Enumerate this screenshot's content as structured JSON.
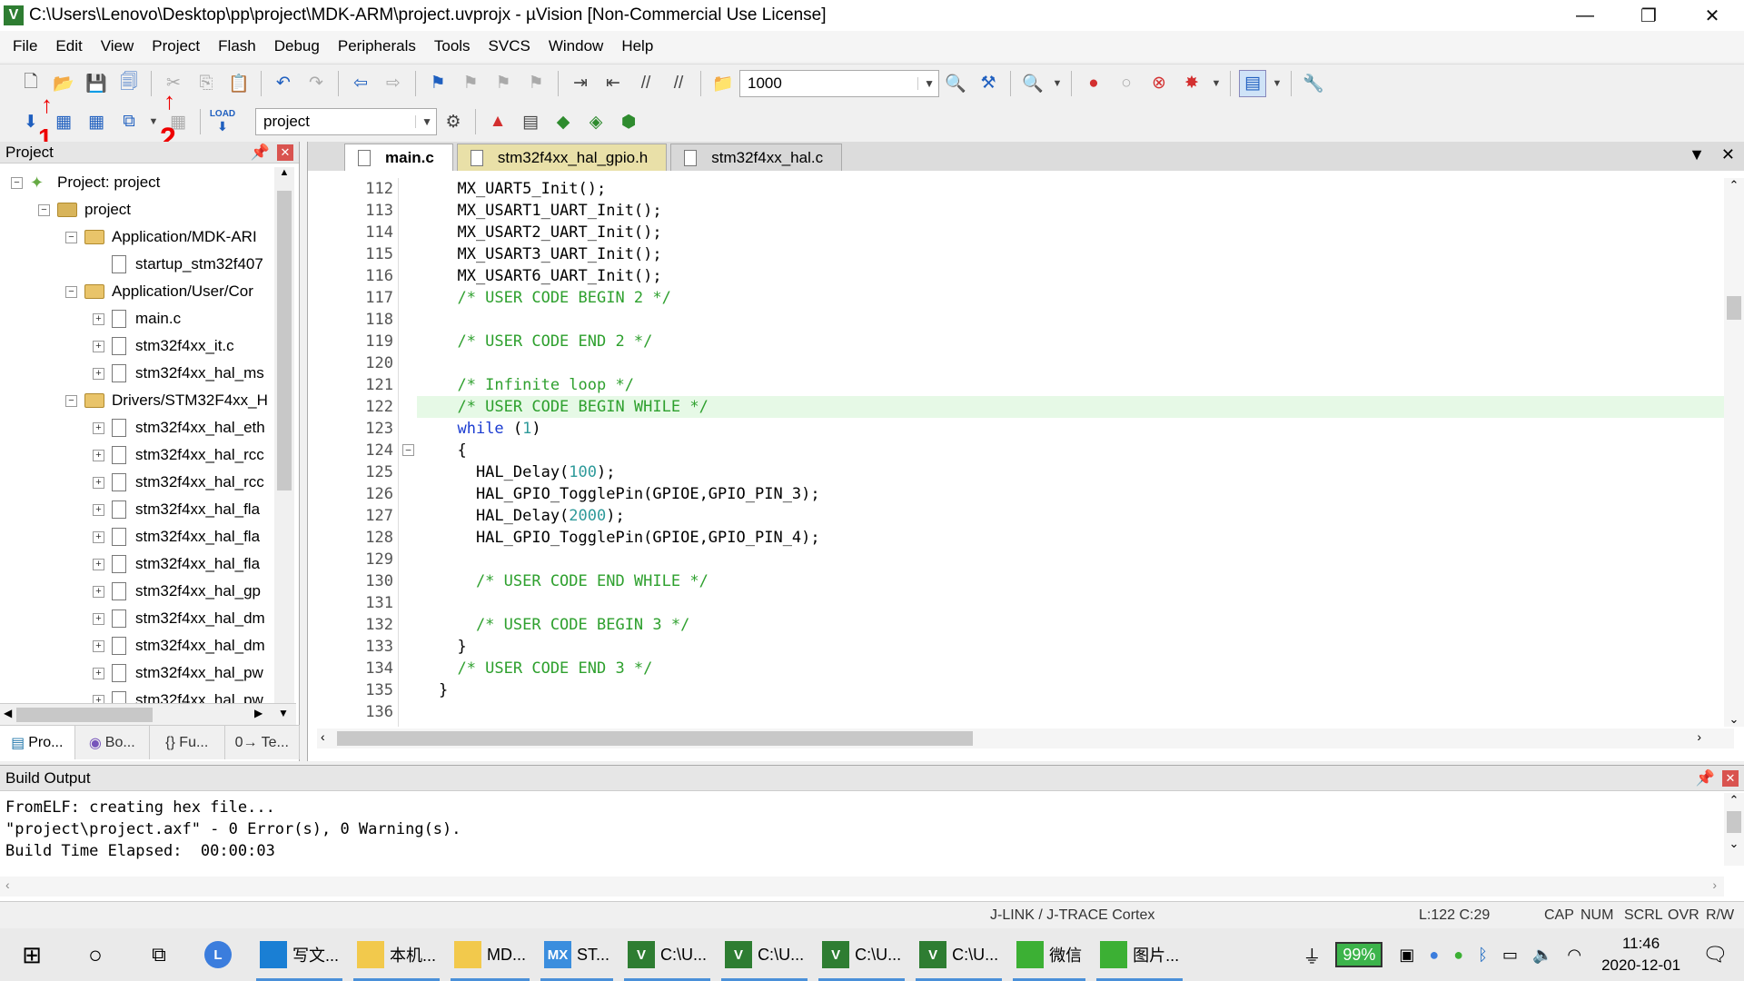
{
  "window": {
    "title": "C:\\Users\\Lenovo\\Desktop\\pp\\project\\MDK-ARM\\project.uvprojx - µVision  [Non-Commercial Use License]",
    "icon_label": "V",
    "buttons": [
      "minimize-icon",
      "restore-icon",
      "close-icon"
    ]
  },
  "menu": [
    "File",
    "Edit",
    "View",
    "Project",
    "Flash",
    "Debug",
    "Peripherals",
    "Tools",
    "SVCS",
    "Window",
    "Help"
  ],
  "toolbar1": {
    "find_value": "1000"
  },
  "toolbar2": {
    "target_value": "project",
    "load_label": "LOAD"
  },
  "annotations": {
    "arrow1": "1",
    "arrow2": "2"
  },
  "project_panel": {
    "title": "Project",
    "tree": [
      {
        "label": "Project: project",
        "level": 0,
        "type": "root",
        "expander": "⊟"
      },
      {
        "label": "project",
        "level": 1,
        "type": "target",
        "expander": "⊟"
      },
      {
        "label": "Application/MDK-ARI",
        "level": 2,
        "type": "folder",
        "expander": "⊟"
      },
      {
        "label": "startup_stm32f407",
        "level": 3,
        "type": "file",
        "expander": ""
      },
      {
        "label": "Application/User/Cor",
        "level": 2,
        "type": "folder",
        "expander": "⊟"
      },
      {
        "label": "main.c",
        "level": 3,
        "type": "file",
        "expander": "⊞"
      },
      {
        "label": "stm32f4xx_it.c",
        "level": 3,
        "type": "file",
        "expander": "⊞"
      },
      {
        "label": "stm32f4xx_hal_ms",
        "level": 3,
        "type": "file",
        "expander": "⊞"
      },
      {
        "label": "Drivers/STM32F4xx_H",
        "level": 2,
        "type": "folder",
        "expander": "⊟"
      },
      {
        "label": "stm32f4xx_hal_eth",
        "level": 3,
        "type": "file",
        "expander": "⊞"
      },
      {
        "label": "stm32f4xx_hal_rcc",
        "level": 3,
        "type": "file",
        "expander": "⊞"
      },
      {
        "label": "stm32f4xx_hal_rcc",
        "level": 3,
        "type": "file",
        "expander": "⊞"
      },
      {
        "label": "stm32f4xx_hal_fla",
        "level": 3,
        "type": "file",
        "expander": "⊞"
      },
      {
        "label": "stm32f4xx_hal_fla",
        "level": 3,
        "type": "file",
        "expander": "⊞"
      },
      {
        "label": "stm32f4xx_hal_fla",
        "level": 3,
        "type": "file",
        "expander": "⊞"
      },
      {
        "label": "stm32f4xx_hal_gp",
        "level": 3,
        "type": "file",
        "expander": "⊞"
      },
      {
        "label": "stm32f4xx_hal_dm",
        "level": 3,
        "type": "file",
        "expander": "⊞"
      },
      {
        "label": "stm32f4xx_hal_dm",
        "level": 3,
        "type": "file",
        "expander": "⊞"
      },
      {
        "label": "stm32f4xx_hal_pw",
        "level": 3,
        "type": "file",
        "expander": "⊞"
      },
      {
        "label": "stm32f4xx_hal_pw",
        "level": 3,
        "type": "file",
        "expander": "⊞"
      }
    ],
    "tabs": [
      "Pro...",
      "Bo...",
      "{} Fu...",
      "0→ Te..."
    ]
  },
  "editor": {
    "tabs": [
      {
        "label": "main.c",
        "state": "active"
      },
      {
        "label": "stm32f4xx_hal_gpio.h",
        "state": "modified"
      },
      {
        "label": "stm32f4xx_hal.c",
        "state": "inactive"
      }
    ],
    "lines": [
      {
        "n": "112",
        "kind": "plain",
        "text": "  MX_UART5_Init();"
      },
      {
        "n": "113",
        "kind": "plain",
        "text": "  MX_USART1_UART_Init();"
      },
      {
        "n": "114",
        "kind": "plain",
        "text": "  MX_USART2_UART_Init();"
      },
      {
        "n": "115",
        "kind": "plain",
        "text": "  MX_USART3_UART_Init();"
      },
      {
        "n": "116",
        "kind": "plain",
        "text": "  MX_USART6_UART_Init();"
      },
      {
        "n": "117",
        "kind": "comment",
        "text": "  /* USER CODE BEGIN 2 */"
      },
      {
        "n": "118",
        "kind": "plain",
        "text": ""
      },
      {
        "n": "119",
        "kind": "comment",
        "text": "  /* USER CODE END 2 */"
      },
      {
        "n": "120",
        "kind": "plain",
        "text": ""
      },
      {
        "n": "121",
        "kind": "comment",
        "text": "  /* Infinite loop */"
      },
      {
        "n": "122",
        "kind": "comment",
        "text": "  /* USER CODE BEGIN WHILE */",
        "highlight": true
      },
      {
        "n": "123",
        "kind": "while",
        "text": "  while (1)"
      },
      {
        "n": "124",
        "kind": "plain",
        "text": "  {",
        "fold": "−"
      },
      {
        "n": "125",
        "kind": "delay",
        "text": "    HAL_Delay(100);"
      },
      {
        "n": "126",
        "kind": "plain",
        "text": "    HAL_GPIO_TogglePin(GPIOE,GPIO_PIN_3);"
      },
      {
        "n": "127",
        "kind": "delay",
        "text": "    HAL_Delay(2000);"
      },
      {
        "n": "128",
        "kind": "plain",
        "text": "    HAL_GPIO_TogglePin(GPIOE,GPIO_PIN_4);"
      },
      {
        "n": "129",
        "kind": "plain",
        "text": ""
      },
      {
        "n": "130",
        "kind": "comment",
        "text": "    /* USER CODE END WHILE */"
      },
      {
        "n": "131",
        "kind": "plain",
        "text": ""
      },
      {
        "n": "132",
        "kind": "comment",
        "text": "    /* USER CODE BEGIN 3 */"
      },
      {
        "n": "133",
        "kind": "plain",
        "text": "  }"
      },
      {
        "n": "134",
        "kind": "comment",
        "text": "  /* USER CODE END 3 */"
      },
      {
        "n": "135",
        "kind": "plain",
        "text": "}"
      },
      {
        "n": "136",
        "kind": "plain",
        "text": ""
      }
    ]
  },
  "build_output": {
    "title": "Build Output",
    "lines": [
      "FromELF: creating hex file...",
      "\"project\\project.axf\" - 0 Error(s), 0 Warning(s).",
      "Build Time Elapsed:  00:00:03"
    ]
  },
  "statusbar": {
    "debugger": "J-LINK / J-TRACE Cortex",
    "position": "L:122 C:29",
    "flags": [
      "CAP",
      "NUM",
      "SCRL",
      "OVR",
      "R/W"
    ]
  },
  "taskbar": {
    "items": [
      {
        "label": "写文...",
        "color": "#1a7fd4",
        "icon": "edge-icon"
      },
      {
        "label": "本机...",
        "color": "#f2c94c",
        "icon": "folder-icon"
      },
      {
        "label": "MD...",
        "color": "#f2c94c",
        "icon": "folder-icon"
      },
      {
        "label": "ST...",
        "color": "#3b8ede",
        "icon": "mx-icon",
        "badge": "MX"
      },
      {
        "label": "C:\\U...",
        "color": "#2e7d32",
        "icon": "uvision-icon",
        "badge": "V"
      },
      {
        "label": "C:\\U...",
        "color": "#2e7d32",
        "icon": "uvision-icon",
        "badge": "V"
      },
      {
        "label": "C:\\U...",
        "color": "#2e7d32",
        "icon": "uvision-icon",
        "badge": "V"
      },
      {
        "label": "C:\\U...",
        "color": "#2e7d32",
        "icon": "uvision-icon",
        "badge": "V"
      },
      {
        "label": "微信",
        "color": "#3cb034",
        "icon": "wechat-icon"
      },
      {
        "label": "图片...",
        "color": "#3cb034",
        "icon": "wechat-icon"
      }
    ],
    "battery": "99%",
    "time": "11:46",
    "date": "2020-12-01"
  }
}
